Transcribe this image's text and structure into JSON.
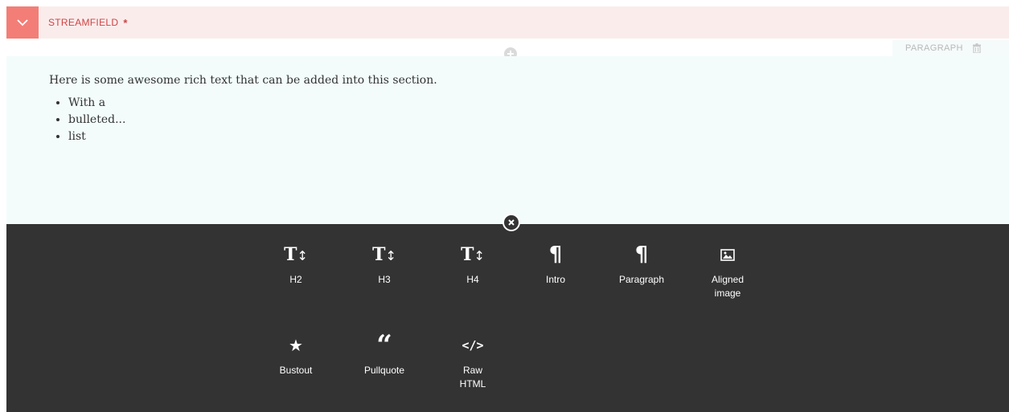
{
  "field": {
    "label": "STREAMFIELD",
    "required_mark": "*"
  },
  "block": {
    "type_label": "PARAGRAPH",
    "intro": "Here is some awesome rich text that can be added into this section.",
    "bullets": [
      "With a",
      "bulleted...",
      "list"
    ]
  },
  "chooser": {
    "items": [
      {
        "label": "H2",
        "icon": "heading-icon"
      },
      {
        "label": "H3",
        "icon": "heading-icon"
      },
      {
        "label": "H4",
        "icon": "heading-icon"
      },
      {
        "label": "Intro",
        "icon": "pilcrow-icon"
      },
      {
        "label": "Paragraph",
        "icon": "pilcrow-icon"
      },
      {
        "label": "Aligned image",
        "icon": "image-icon"
      },
      {
        "label": "Bustout",
        "icon": "star-icon"
      },
      {
        "label": "Pullquote",
        "icon": "quote-icon"
      },
      {
        "label": "Raw HTML",
        "icon": "code-icon"
      }
    ]
  },
  "colors": {
    "header_bg": "#fbecec",
    "toggle_bg": "#f37e77",
    "label_red": "#cd4444",
    "block_bg": "#f3fcfb",
    "chooser_bg": "#333333"
  }
}
